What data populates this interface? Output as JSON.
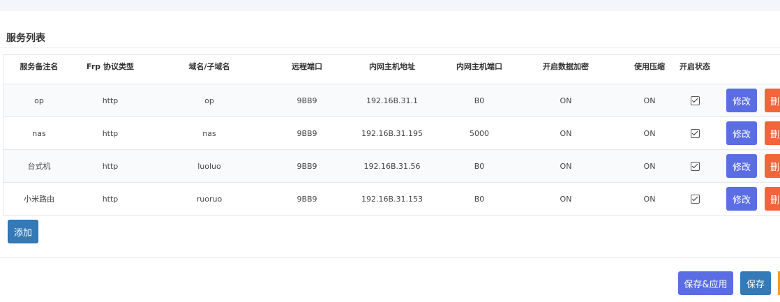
{
  "section": {
    "title": "服务列表"
  },
  "table": {
    "columns": [
      "服务备注名",
      "Frp 协议类型",
      "域名/子域名",
      "远程端口",
      "内网主机地址",
      "内网主机端口",
      "开启数据加密",
      "使用压缩",
      "开启状态"
    ],
    "rows": [
      {
        "name": "op",
        "protocol": "http",
        "domain": "op",
        "remote_port": "9BB9",
        "host": "192.16B.31.1",
        "host_port": "B0",
        "encrypt": "ON",
        "compress": "ON",
        "enabled": true
      },
      {
        "name": "nas",
        "protocol": "http",
        "domain": "nas",
        "remote_port": "9BB9",
        "host": "192.16B.31.195",
        "host_port": "5000",
        "encrypt": "ON",
        "compress": "ON",
        "enabled": true
      },
      {
        "name": "台式机",
        "protocol": "http",
        "domain": "luoluo",
        "remote_port": "9BB9",
        "host": "192.16B.31.56",
        "host_port": "B0",
        "encrypt": "ON",
        "compress": "ON",
        "enabled": true
      },
      {
        "name": "小米路由",
        "protocol": "http",
        "domain": "ruoruo",
        "remote_port": "9BB9",
        "host": "192.16B.31.153",
        "host_port": "B0",
        "encrypt": "ON",
        "compress": "ON",
        "enabled": true
      }
    ],
    "edit_label": "修改",
    "delete_label": "删"
  },
  "actions": {
    "add_label": "添加"
  },
  "footer": {
    "save_apply_label": "保存&应用",
    "save_label": "保存"
  },
  "colors": {
    "primary": "#5b6de3",
    "blue": "#337ab7",
    "danger": "#f2643a",
    "warning": "#f0a020"
  }
}
